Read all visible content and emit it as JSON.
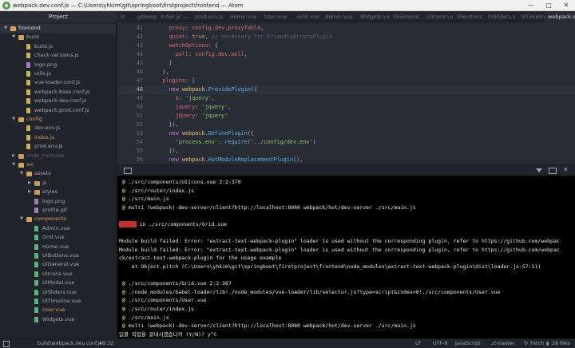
{
  "window": {
    "title": "webpack.dev.conf.js — C:\\Users\\yhkim\\git\\springboot\\firstproject\\frontend — Atom"
  },
  "tabs": {
    "project": "Project",
    "items": [
      "nl",
      ".gitkeep",
      "index.js —...",
      "prod.env.js",
      "Home.vue",
      "User.vue",
      "Grid.vue",
      "Admin.vue",
      "Widgets.vue",
      "UIGeneral...",
      "UIIcons.vue",
      "UIButtons...",
      "UISliders.v...",
      "UITimeline...",
      "webpack.d..."
    ]
  },
  "tree": [
    {
      "label": "frontend",
      "type": "folder",
      "open": true,
      "depth": 0,
      "selected": true
    },
    {
      "label": "build",
      "type": "folder",
      "open": true,
      "depth": 1
    },
    {
      "label": "build.js",
      "type": "js",
      "depth": 2
    },
    {
      "label": "check-versions.js",
      "type": "js",
      "depth": 2
    },
    {
      "label": "logo.png",
      "type": "img",
      "depth": 2
    },
    {
      "label": "utils.js",
      "type": "js",
      "depth": 2
    },
    {
      "label": "vue-loader.conf.js",
      "type": "js",
      "depth": 2
    },
    {
      "label": "webpack.base.conf.js",
      "type": "js",
      "depth": 2
    },
    {
      "label": "webpack.dev.conf.js",
      "type": "js",
      "depth": 2
    },
    {
      "label": "webpack.prod.conf.js",
      "type": "js",
      "depth": 2
    },
    {
      "label": "config",
      "type": "folder",
      "open": true,
      "depth": 1,
      "modified": true
    },
    {
      "label": "dev.env.js",
      "type": "js",
      "depth": 2
    },
    {
      "label": "index.js",
      "type": "js",
      "depth": 2,
      "modified": true
    },
    {
      "label": "prod.env.js",
      "type": "js",
      "depth": 2
    },
    {
      "label": "node_modules",
      "type": "folder",
      "open": false,
      "depth": 1,
      "muted": true
    },
    {
      "label": "src",
      "type": "folder",
      "open": true,
      "depth": 1,
      "modified": true
    },
    {
      "label": "assets",
      "type": "folder",
      "open": true,
      "depth": 2
    },
    {
      "label": "js",
      "type": "folder",
      "open": false,
      "depth": 3
    },
    {
      "label": "styles",
      "type": "folder",
      "open": false,
      "depth": 3
    },
    {
      "label": "logo.png",
      "type": "img",
      "depth": 3
    },
    {
      "label": "profile.gif",
      "type": "img",
      "depth": 3
    },
    {
      "label": "components",
      "type": "folder",
      "open": true,
      "depth": 2,
      "modified": true
    },
    {
      "label": "Admin.vue",
      "type": "vue",
      "depth": 3
    },
    {
      "label": "Grid.vue",
      "type": "vue",
      "depth": 3
    },
    {
      "label": "Home.vue",
      "type": "vue",
      "depth": 3
    },
    {
      "label": "UIButtons.vue",
      "type": "vue",
      "depth": 3
    },
    {
      "label": "UIGeneral.vue",
      "type": "vue",
      "depth": 3
    },
    {
      "label": "UIIcons.vue",
      "type": "vue",
      "depth": 3
    },
    {
      "label": "UIModal.vue",
      "type": "vue",
      "depth": 3
    },
    {
      "label": "UISliders.vue",
      "type": "vue",
      "depth": 3
    },
    {
      "label": "UITimeline.vue",
      "type": "vue",
      "depth": 3
    },
    {
      "label": "User.vue",
      "type": "vue",
      "depth": 3,
      "modified": true
    },
    {
      "label": "Widgets.vue",
      "type": "vue",
      "depth": 3
    }
  ],
  "editor": {
    "current_line": "48",
    "lines": [
      {
        "n": "41",
        "html": "      <span class='p'>proxy</span>: <span class='p'>config</span>.<span class='p'>dev</span>.<span class='p'>proxyTable</span>,"
      },
      {
        "n": "42",
        "html": "      <span class='p'>quiet</span>: <span class='n'>true</span>, <span class='c'>// necessary for FriendlyErrorsPlugin</span>"
      },
      {
        "n": "43",
        "html": "      <span class='p'>watchOptions</span>: {"
      },
      {
        "n": "44",
        "html": "        <span class='p'>poll</span>: <span class='p'>config</span>.<span class='p'>dev</span>.<span class='p'>poll</span>,"
      },
      {
        "n": "45",
        "html": "      }"
      },
      {
        "n": "46",
        "html": "    },"
      },
      {
        "n": "47",
        "html": "    <span class='p'>plugins</span>: ["
      },
      {
        "n": "48",
        "html": "      <span class='k'>new</span> <span class='y'>webpack</span>.<span class='f'>ProvidePlugin</span>({"
      },
      {
        "n": "49",
        "html": "        <span class='p'>$</span>: <span class='s'>'jquery'</span>,"
      },
      {
        "n": "50",
        "html": "        <span class='p'>jquery</span>: <span class='s'>'jquery'</span>,"
      },
      {
        "n": "51",
        "html": "        <span class='p'>jQuery</span>: <span class='s'>'jquery'</span>"
      },
      {
        "n": "52",
        "html": "      }),"
      },
      {
        "n": "53",
        "html": "      <span class='k'>new</span> <span class='y'>webpack</span>.<span class='f'>DefinePlugin</span>({"
      },
      {
        "n": "54",
        "html": "        <span class='s'>'process.env'</span>: <span class='f'>require</span>(<span class='s'>'../config/dev.env'</span>)"
      },
      {
        "n": "55",
        "html": "      }),"
      },
      {
        "n": "56",
        "html": "      <span class='k'>new</span> <span class='y'>webpack</span>.<span class='f'>HotModuleReplacementPlugin</span>(),"
      }
    ]
  },
  "terminal": {
    "lines": [
      " @ ./src/components/UIIcons.vue 2:2-370",
      " @ ./src/router/index.js",
      " @ ./src/main.js",
      " @ multi (webpack)-dev-server/client?http://localhost:8080 webpack/hot/dev-server ./src/main.js",
      "",
      "__ERROR__ in ./src/components/Grid.vue",
      "",
      "Module build failed: Error: \"extract-text-webpack-plugin\" loader is used without the corresponding plugin, refer to https://github.com/webpac",
      "Module build failed: Error: \"extract-text-webpack-plugin\" loader is used without the corresponding plugin, refer to https://github.com/webpac",
      "ck/extract-text-webpack-plugin for the usage example",
      "    at Object.pitch (C:\\Users\\yhkim\\git\\springboot\\firstproject\\frontend\\node_modules\\extract-text-webpack-plugin\\dist\\loader.js:57:11)",
      "",
      " @ ./src/components/Grid.vue 2:2-367",
      " @ ./node_modules/babel-loader/lib!./node_modules/vue-loader/lib/selector.js?type=script&index=0!./src/components/User.vue",
      " @ ./src/components/User.vue",
      " @ ./src/router/index.js",
      " @ ./src/main.js",
      " @ multi (webpack)-dev-server/client?http://localhost:8080 webpack/hot/dev-server ./src/main.js",
      "일괄 작업을 끝내시겠습니까 (Y/N)? y^C"
    ],
    "error_badge": "ERROR"
  },
  "status": {
    "left_tab": "build\\webpack.dev.conf.js",
    "cursor": "48:32",
    "eol": "LF",
    "encoding": "UTF-8",
    "grammar": "JavaScript",
    "branch": "master",
    "fetch": "Fetch",
    "files": "28 files"
  }
}
